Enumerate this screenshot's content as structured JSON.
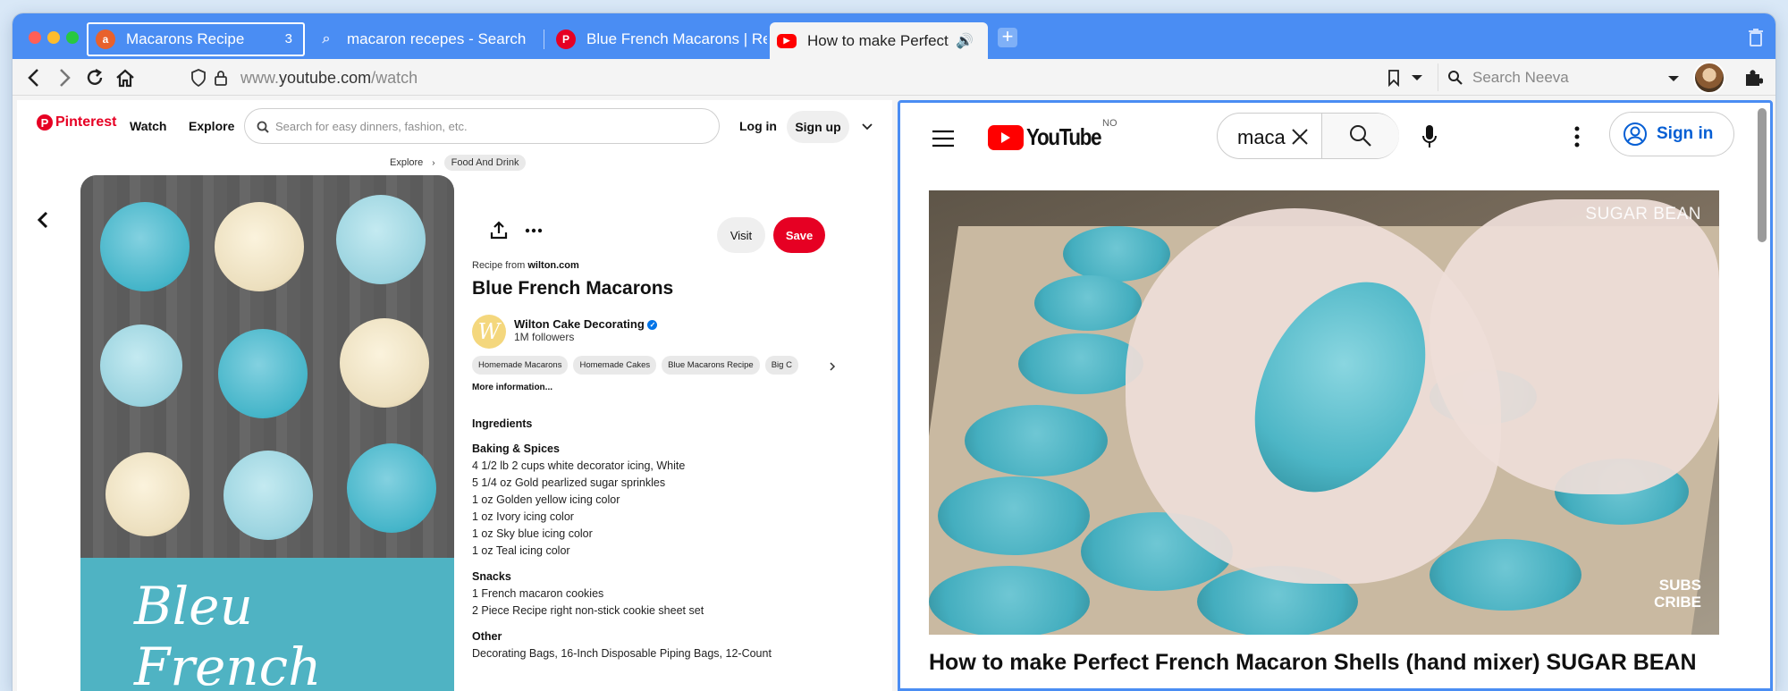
{
  "browser": {
    "tabs": [
      {
        "title": "Macarons Recipe",
        "badge": "3",
        "favicon": "allrecipes-icon",
        "state": "selected"
      },
      {
        "title": "macaron recepes - Search",
        "favicon": "search-icon",
        "state": "normal"
      },
      {
        "title": "Blue French Macarons | Re",
        "favicon": "pinterest-icon",
        "state": "normal"
      },
      {
        "title": "How to make Perfect F",
        "favicon": "youtube-icon",
        "state": "active"
      }
    ],
    "url_scheme": "www.",
    "url_host": "youtube.com",
    "url_path": "/watch",
    "search_placeholder": "Search Neeva"
  },
  "pinterest": {
    "logo": "Pinterest",
    "nav_watch": "Watch",
    "nav_explore": "Explore",
    "search_placeholder": "Search for easy dinners, fashion, etc.",
    "login": "Log in",
    "signup": "Sign up",
    "breadcrumb": [
      "Explore",
      "Food And Drink"
    ],
    "image_text": "Bleu French",
    "visit": "Visit",
    "save": "Save",
    "recipe_from_label": "Recipe from",
    "recipe_from_site": "wilton.com",
    "title": "Blue French Macarons",
    "author": "Wilton Cake Decorating",
    "followers": "1M followers",
    "tags": [
      "Homemade Macarons",
      "Homemade Cakes",
      "Blue Macarons Recipe",
      "Big C"
    ],
    "more_info": "More information...",
    "ingredients_heading": "Ingredients",
    "sections": [
      {
        "heading": "Baking & Spices",
        "items": [
          "4 1/2 lb 2 cups white decorator icing, White",
          "5 1/4 oz Gold pearlized sugar sprinkles",
          "1 oz Golden yellow icing color",
          "1 oz Ivory icing color",
          "1 oz Sky blue icing color",
          "1 oz Teal icing color"
        ]
      },
      {
        "heading": "Snacks",
        "items": [
          "1 French macaron cookies",
          "2 Piece Recipe right non-stick cookie sheet set"
        ]
      },
      {
        "heading": "Other",
        "items": [
          "Decorating Bags, 16-Inch Disposable Piping Bags, 12-Count"
        ]
      }
    ]
  },
  "youtube": {
    "logo": "YouTube",
    "country": "NO",
    "search_query": "maca",
    "sign_in": "Sign in",
    "watermark": "SUGAR BEAN",
    "subscribe_line1": "SUBS",
    "subscribe_line2": "CRIBE",
    "video_title": "How to make Perfect French Macaron Shells (hand mixer) SUGAR BEAN"
  },
  "colors": {
    "tab_strip": "#4a8df3",
    "pinterest_red": "#e60023",
    "youtube_red": "#ff0000",
    "youtube_blue": "#065fd4"
  }
}
